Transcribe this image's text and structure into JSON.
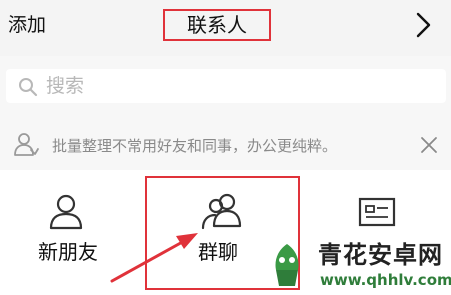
{
  "header": {
    "add_label": "添加",
    "title": "联系人",
    "next_icon": "chevron-right-icon"
  },
  "search": {
    "placeholder": "搜索",
    "icon": "search-icon"
  },
  "tip": {
    "icon": "people-icon",
    "text": "批量整理不常用好友和同事，办公更纯粹。",
    "close_icon": "close-icon"
  },
  "grid": {
    "items": [
      {
        "label": "新朋友",
        "icon": "person-icon"
      },
      {
        "label": "群聊",
        "icon": "group-icon"
      },
      {
        "label": "",
        "icon": "contact-card-icon"
      }
    ]
  },
  "annotation": {
    "color": "#e0323a"
  },
  "watermark": {
    "name": "青花安卓网",
    "url": "www.qhhlv.com"
  },
  "colors": {
    "background": "#f7f7f7",
    "header": "#f4f4f4",
    "highlight": "#e0323a",
    "watermark_green": "#2f7d3a"
  }
}
